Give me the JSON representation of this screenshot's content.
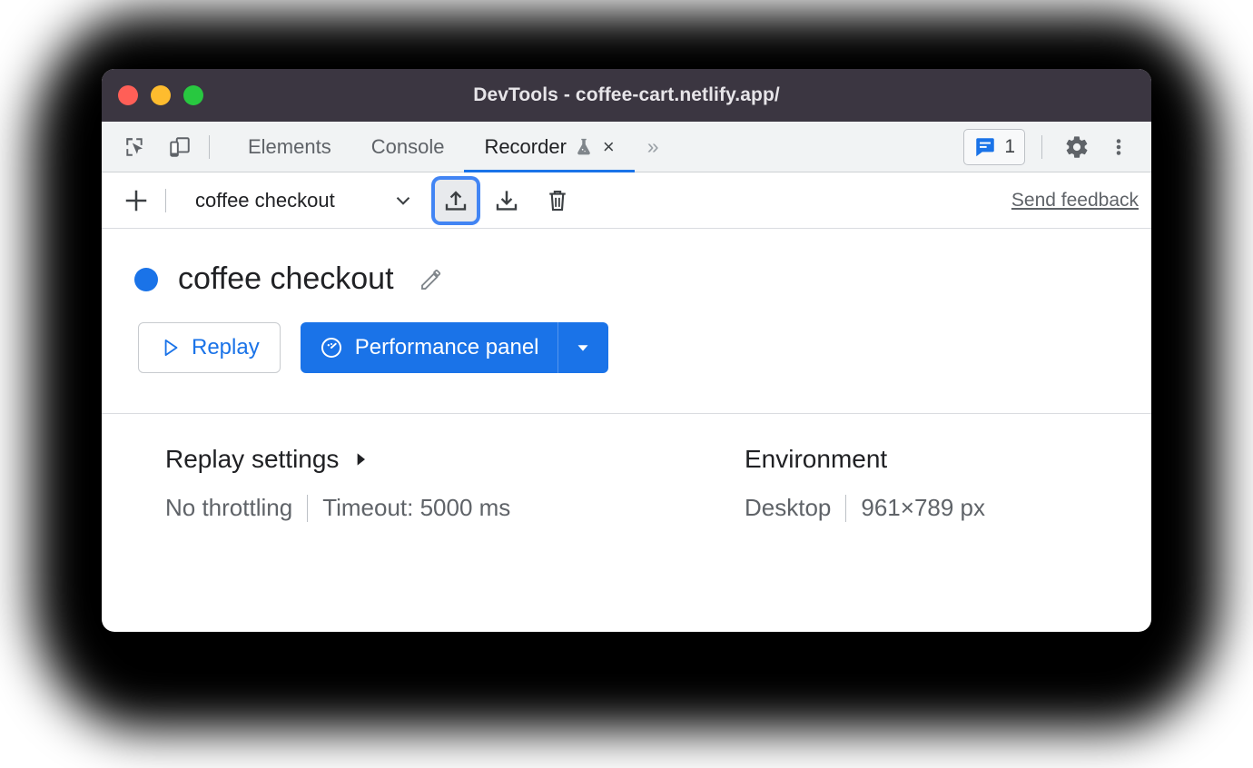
{
  "window": {
    "title": "DevTools - coffee-cart.netlify.app/",
    "traffic_lights": [
      {
        "name": "close",
        "color": "#ff5f57"
      },
      {
        "name": "minimize",
        "color": "#febc2e"
      },
      {
        "name": "zoom",
        "color": "#28c840"
      }
    ]
  },
  "tabbar": {
    "inspect_icon": "inspect-element-icon",
    "device_icon": "device-toolbar-icon",
    "tabs": [
      {
        "label": "Elements",
        "active": false
      },
      {
        "label": "Console",
        "active": false
      },
      {
        "label": "Recorder",
        "active": true,
        "experiment_icon": "flask-icon",
        "close_label": "×"
      }
    ],
    "more_tabs": "»",
    "issues_count": "1",
    "issues_icon": "issues-message-icon",
    "settings_icon": "gear-icon",
    "menu_icon": "three-dot-menu-icon"
  },
  "recorder_toolbar": {
    "add_label": "+",
    "recording_name": "coffee checkout",
    "dropdown_icon": "chevron-down-icon",
    "import_icon": "import-upload-icon",
    "export_icon": "export-download-icon",
    "delete_icon": "trash-icon",
    "feedback_label": "Send feedback",
    "focused_button": "import"
  },
  "recording": {
    "status_dot_color": "#1a73e8",
    "title": "coffee checkout",
    "edit_icon": "pencil-edit-icon"
  },
  "actions": {
    "replay_label": "Replay",
    "replay_icon": "play-triangle-icon",
    "performance_label": "Performance panel",
    "performance_icon": "performance-gauge-icon",
    "performance_dropdown_icon": "caret-down-icon"
  },
  "settings": {
    "replay": {
      "title": "Replay settings",
      "expand_icon": "caret-right-icon",
      "throttling": "No throttling",
      "timeout": "Timeout: 5000 ms"
    },
    "environment": {
      "title": "Environment",
      "device": "Desktop",
      "viewport": "961×789 px"
    }
  },
  "colors": {
    "accent_blue": "#1a73e8",
    "focus_blue": "#4285f4",
    "titlebar_bg": "#3b3641",
    "tabbar_bg": "#f1f3f4"
  }
}
